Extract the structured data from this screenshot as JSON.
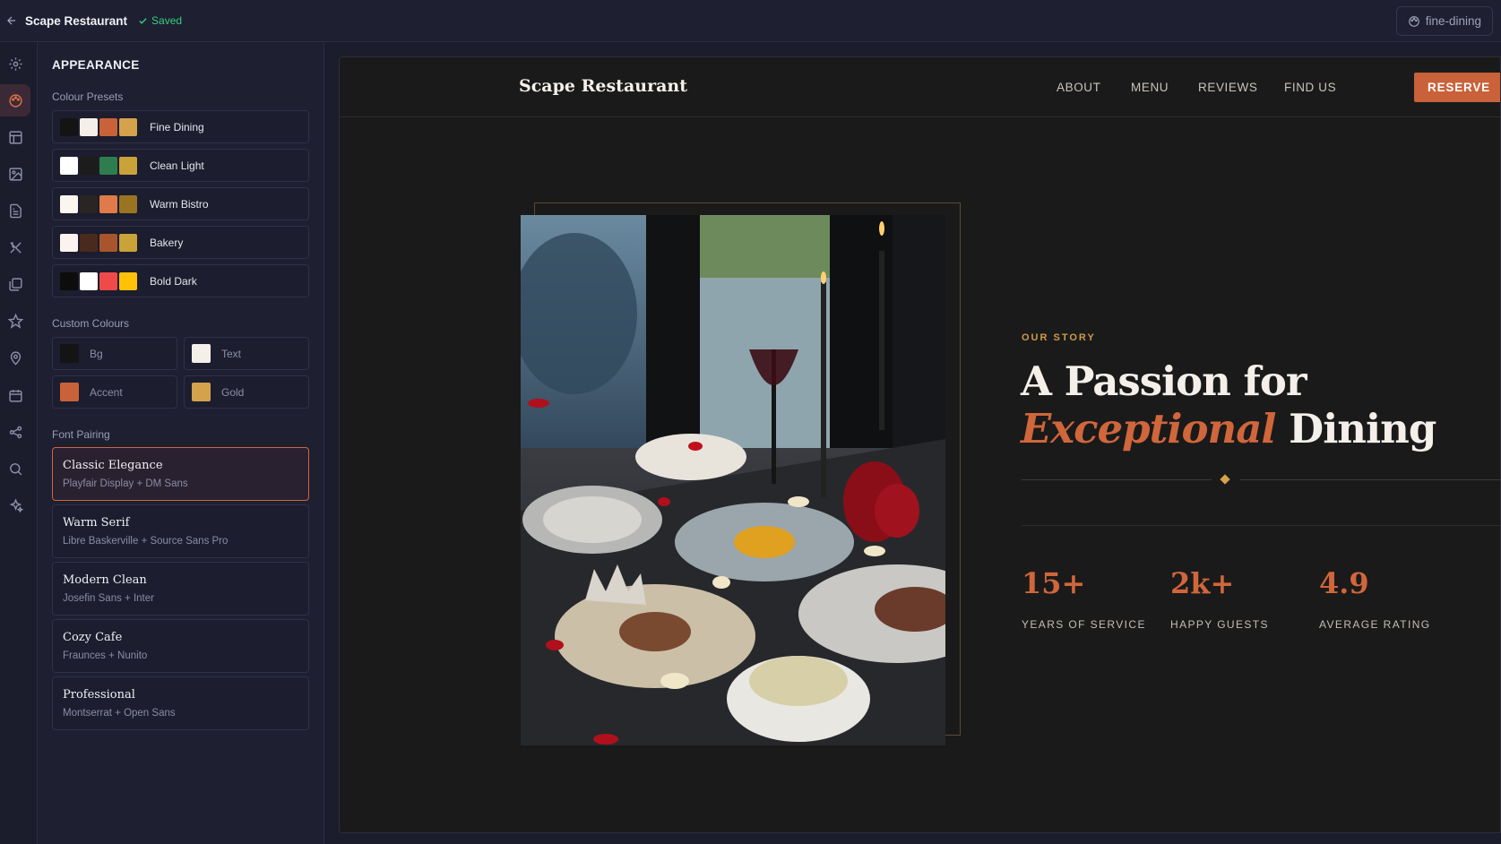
{
  "topbar": {
    "title": "Scape Restaurant",
    "saved_label": "Saved",
    "slug": "fine-dining"
  },
  "rail": {
    "items": [
      "gear-icon",
      "palette-icon",
      "layout-icon",
      "image-icon",
      "document-icon",
      "utensils-icon",
      "gallery-icon",
      "star-icon",
      "map-pin-icon",
      "calendar-icon",
      "share-icon",
      "search-icon",
      "sparkle-icon"
    ],
    "active": "palette-icon"
  },
  "panel": {
    "title": "APPEARANCE",
    "presets_label": "Colour Presets",
    "presets": [
      {
        "label": "Fine Dining",
        "colors": [
          "#141414",
          "#f4efe8",
          "#c9613a",
          "#d4a24a"
        ]
      },
      {
        "label": "Clean Light",
        "colors": [
          "#ffffff",
          "#1c1c1c",
          "#2e7d4f",
          "#c9a23a"
        ]
      },
      {
        "label": "Warm Bistro",
        "colors": [
          "#faf5ef",
          "#2a2522",
          "#e07a4a",
          "#9a7420"
        ]
      },
      {
        "label": "Bakery",
        "colors": [
          "#fdf3ee",
          "#4a2a1d",
          "#a8552e",
          "#c9a23a"
        ]
      },
      {
        "label": "Bold Dark",
        "colors": [
          "#0d0d0d",
          "#ffffff",
          "#ef4a4a",
          "#ffc107"
        ]
      }
    ],
    "custom_label": "Custom Colours",
    "custom": [
      {
        "label": "Bg",
        "color": "#141414"
      },
      {
        "label": "Text",
        "color": "#f4efe8"
      },
      {
        "label": "Accent",
        "color": "#c9613a"
      },
      {
        "label": "Gold",
        "color": "#d4a24a"
      }
    ],
    "font_label": "Font Pairing",
    "fonts": [
      {
        "name": "Classic Elegance",
        "pair": "Playfair Display + DM Sans",
        "selected": true
      },
      {
        "name": "Warm Serif",
        "pair": "Libre Baskerville + Source Sans Pro",
        "selected": false
      },
      {
        "name": "Modern Clean",
        "pair": "Josefin Sans + Inter",
        "selected": false
      },
      {
        "name": "Cozy Cafe",
        "pair": "Fraunces + Nunito",
        "selected": false
      },
      {
        "name": "Professional",
        "pair": "Montserrat + Open Sans",
        "selected": false
      }
    ]
  },
  "preview": {
    "brand": "Scape Restaurant",
    "nav": [
      "ABOUT",
      "MENU",
      "REVIEWS",
      "FIND US"
    ],
    "reserve": "RESERVE",
    "eyebrow": "OUR STORY",
    "headline_line1": "A Passion for",
    "headline_accent": "Exceptional",
    "headline_rest": "Dining",
    "stats": [
      {
        "value": "15+",
        "label": "YEARS OF SERVICE"
      },
      {
        "value": "2k+",
        "label": "HAPPY GUESTS"
      },
      {
        "value": "4.9",
        "label": "AVERAGE RATING"
      }
    ]
  }
}
